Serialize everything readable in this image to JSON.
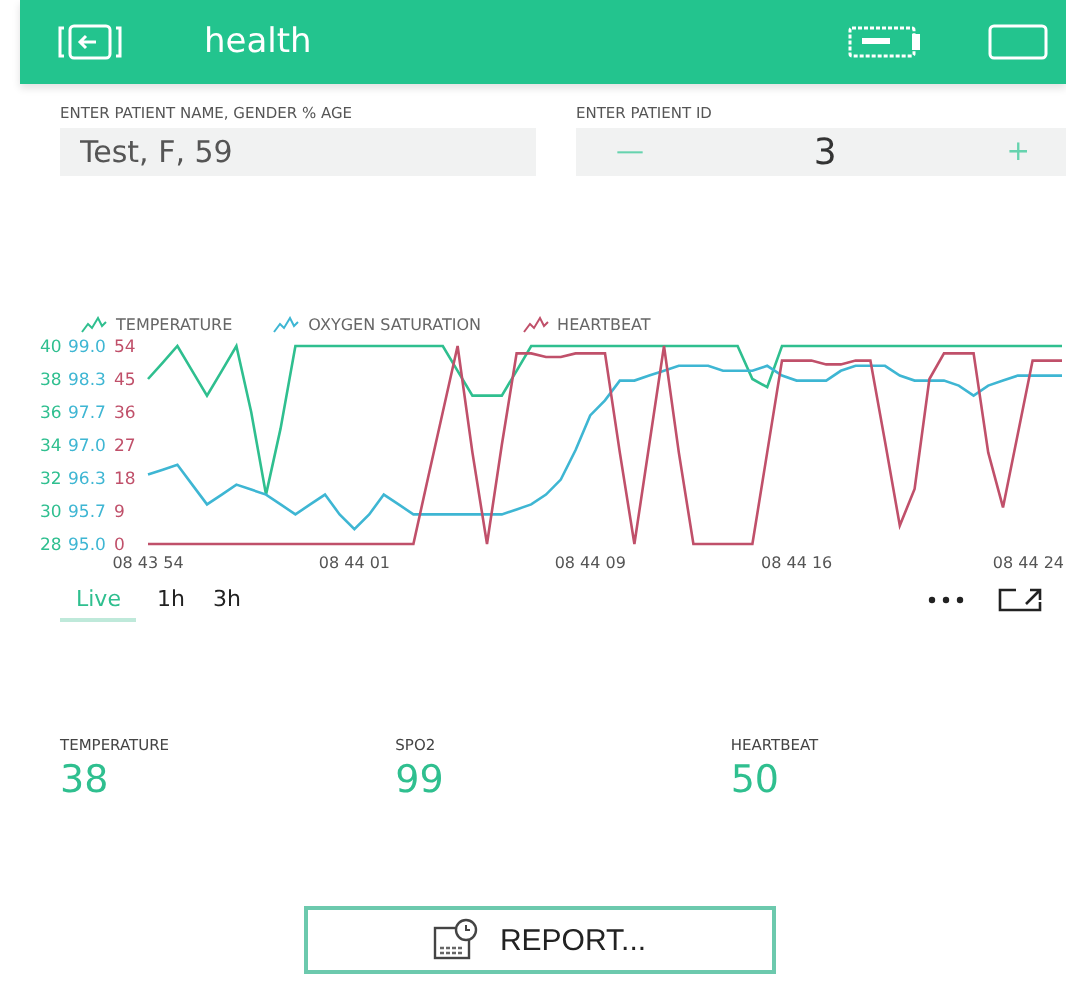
{
  "header": {
    "title": "health"
  },
  "name_field": {
    "label": "ENTER PATIENT NAME, GENDER % AGE",
    "value": "Test, F, 59"
  },
  "id_stepper": {
    "label": "ENTER PATIENT ID",
    "value": "3",
    "decrement": "—",
    "increment": "+"
  },
  "chart": {
    "layers": [
      {
        "chart_data": {
          "type": "line",
          "categories": [
            "08 43 54",
            null,
            null,
            null,
            null,
            null,
            null,
            null,
            null,
            null,
            null,
            null,
            null,
            null,
            "08 44 01",
            null,
            null,
            null,
            null,
            null,
            null,
            null,
            null,
            null,
            null,
            null,
            null,
            null,
            null,
            null,
            "08 44 09",
            null,
            null,
            null,
            null,
            null,
            null,
            null,
            null,
            null,
            null,
            null,
            null,
            null,
            "08 44 16",
            null,
            null,
            null,
            null,
            null,
            null,
            null,
            null,
            null,
            null,
            null,
            null,
            null,
            null,
            null,
            "08 44 24",
            null,
            null
          ],
          "ylim": [
            28,
            40
          ],
          "yticks": [
            40,
            38,
            36,
            34,
            32,
            30,
            28
          ],
          "series": [
            {
              "name": "TEMPERATURE",
              "color": "#2fbf8f",
              "values": [
                38,
                39,
                40,
                38.5,
                37,
                38.5,
                40,
                36,
                31,
                35,
                40,
                40,
                40,
                40,
                40,
                40,
                40,
                40,
                40,
                40,
                40,
                38.5,
                37,
                37,
                37,
                38.5,
                40,
                40,
                40,
                40,
                40,
                40,
                40,
                40,
                40,
                40,
                40,
                40,
                40,
                40,
                40,
                38,
                37.5,
                40,
                40,
                40,
                40,
                40,
                40,
                40,
                40,
                40,
                40,
                40,
                40,
                40,
                40,
                40,
                40,
                40,
                40,
                40,
                40
              ]
            }
          ]
        }
      },
      {
        "chart_data": {
          "type": "line",
          "categories": [
            null,
            null,
            null,
            null,
            null,
            null,
            null,
            null,
            null,
            null,
            null,
            null,
            null,
            null,
            null,
            null,
            null,
            null,
            null,
            null,
            null,
            null,
            null,
            null,
            null,
            null,
            null,
            null,
            null,
            null,
            null,
            null,
            null,
            null,
            null,
            null,
            null,
            null,
            null,
            null,
            null,
            null,
            null,
            null,
            null,
            null,
            null,
            null,
            null,
            null,
            null,
            null,
            null,
            null,
            null,
            null,
            null,
            null,
            null,
            null,
            null,
            null,
            null
          ],
          "ylim": [
            95,
            99
          ],
          "yticks": [
            {
              "value": 99,
              "label": "99.0"
            },
            {
              "value": 98.333,
              "label": "98.3"
            },
            {
              "value": 97.667,
              "label": "97.7"
            },
            {
              "value": 97,
              "label": "97.0"
            },
            {
              "value": 96.333,
              "label": "96.3"
            },
            {
              "value": 95.667,
              "label": "95.7"
            },
            {
              "value": 95,
              "label": "95.0"
            }
          ],
          "series": [
            {
              "name": "OXYGEN SATURATION",
              "color": "#3eb6d3",
              "values": [
                96.4,
                96.5,
                96.6,
                96.2,
                95.8,
                96.0,
                96.2,
                96.1,
                96.0,
                95.8,
                95.6,
                95.8,
                96.0,
                95.6,
                95.3,
                95.6,
                96.0,
                95.8,
                95.6,
                95.6,
                95.6,
                95.6,
                95.6,
                95.6,
                95.6,
                95.7,
                95.8,
                96.0,
                96.3,
                96.9,
                97.6,
                97.9,
                98.3,
                98.3,
                98.4,
                98.5,
                98.6,
                98.6,
                98.6,
                98.5,
                98.5,
                98.5,
                98.6,
                98.4,
                98.3,
                98.3,
                98.3,
                98.5,
                98.6,
                98.6,
                98.6,
                98.4,
                98.3,
                98.3,
                98.3,
                98.2,
                98.0,
                98.2,
                98.3,
                98.4,
                98.4,
                98.4,
                98.4
              ]
            }
          ]
        }
      },
      {
        "chart_data": {
          "type": "line",
          "categories": [
            null,
            null,
            null,
            null,
            null,
            null,
            null,
            null,
            null,
            null,
            null,
            null,
            null,
            null,
            null,
            null,
            null,
            null,
            null,
            null,
            null,
            null,
            null,
            null,
            null,
            null,
            null,
            null,
            null,
            null,
            null,
            null,
            null,
            null,
            null,
            null,
            null,
            null,
            null,
            null,
            null,
            null,
            null,
            null,
            null,
            null,
            null,
            null,
            null,
            null,
            null,
            null,
            null,
            null,
            null,
            null,
            null,
            null,
            null,
            null,
            null,
            null,
            null
          ],
          "ylim": [
            0,
            54
          ],
          "yticks": [
            54,
            45,
            36,
            27,
            18,
            9,
            0
          ],
          "series": [
            {
              "name": "HEARTBEAT",
              "color": "#c0506a",
              "values": [
                0,
                0,
                0,
                0,
                0,
                0,
                0,
                0,
                0,
                0,
                0,
                0,
                0,
                0,
                0,
                0,
                0,
                0,
                0,
                18,
                36,
                54,
                25,
                0,
                27,
                52,
                52,
                51,
                51,
                52,
                52,
                52,
                25,
                0,
                27,
                54,
                25,
                0,
                0,
                0,
                0,
                0,
                25,
                50,
                50,
                50,
                49,
                49,
                50,
                50,
                28,
                5,
                15,
                45,
                52,
                52,
                52,
                25,
                10,
                30,
                50,
                50,
                50
              ]
            }
          ]
        }
      }
    ]
  },
  "range_tabs": [
    {
      "label": "Live",
      "selected": true
    },
    {
      "label": "1h",
      "selected": false
    },
    {
      "label": "3h",
      "selected": false
    }
  ],
  "readouts": [
    {
      "label": "TEMPERATURE",
      "value": "38"
    },
    {
      "label": "SPO2",
      "value": "99"
    },
    {
      "label": "HEARTBEAT",
      "value": "50"
    }
  ],
  "report_button": {
    "label": "REPORT..."
  }
}
